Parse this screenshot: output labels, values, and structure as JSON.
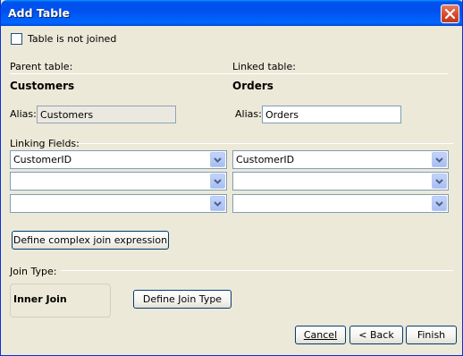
{
  "window": {
    "title": "Add Table"
  },
  "options": {
    "not_joined_label": "Table is not joined",
    "not_joined_checked": false
  },
  "parent": {
    "header": "Parent table:",
    "table_name": "Customers",
    "alias_label": "Alias:",
    "alias_value": "Customers"
  },
  "linked": {
    "header": "Linked table:",
    "table_name": "Orders",
    "alias_label": "Alias:",
    "alias_value": "Orders"
  },
  "linking": {
    "header": "Linking Fields:",
    "rows": [
      {
        "parent_field": "CustomerID",
        "linked_field": "CustomerID"
      },
      {
        "parent_field": "",
        "linked_field": ""
      },
      {
        "parent_field": "",
        "linked_field": ""
      }
    ],
    "complex_button": "Define complex join expression"
  },
  "join": {
    "header": "Join Type:",
    "type_value": "Inner Join",
    "define_button": "Define Join Type"
  },
  "footer": {
    "cancel_label": "Cancel",
    "back_label": "< Back",
    "finish_label": "Finish"
  },
  "icons": {
    "close": "close-icon",
    "dropdown": "chevron-down-icon"
  },
  "colors": {
    "titlebar": "#0053ee",
    "dialog_bg": "#ece9d8",
    "close_button": "#d6492b",
    "button_border": "#003c74"
  }
}
